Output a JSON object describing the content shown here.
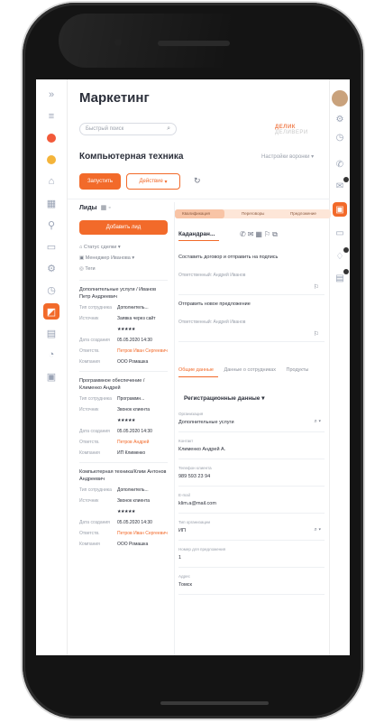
{
  "app": {
    "title": "Маркетинг",
    "search_placeholder": "Быстрый поиск",
    "brand": "ДЕЛИК",
    "brand_suffix": "ДЕЛИВЕРИ"
  },
  "section": {
    "title": "Компьютерная техника",
    "settings": "Настройки воронки"
  },
  "toolbar": {
    "primary": "Запустить",
    "outline": "Действие"
  },
  "leads": {
    "header": "Лиды",
    "add_button": "Добавить лид",
    "filters": [
      "Статус сделки",
      "Менеджер Иванова",
      "Теги"
    ],
    "items": [
      {
        "title": "Дополнительные услуги / Иванов Петр Андреевич",
        "rows": [
          {
            "k": "Тип сотрудника",
            "v": "Дополнитель..."
          },
          {
            "k": "Источник",
            "v": "Заявка через сайт"
          },
          {
            "k": "Дата создания",
            "v": "05.05.2020 14:30"
          },
          {
            "k": "Ответств.",
            "v": "Петров Иван Сергеевич"
          },
          {
            "k": "Компания",
            "v": "ООО Ромашка"
          }
        ]
      },
      {
        "title": "Программное обеспечение / Клименко Андрей",
        "rows": [
          {
            "k": "Тип сотрудника",
            "v": "Программн..."
          },
          {
            "k": "Источник",
            "v": "Звонок клиента"
          },
          {
            "k": "Дата создания",
            "v": "05.05.2020 14:30"
          },
          {
            "k": "Ответств.",
            "v": "Петров Андрей"
          },
          {
            "k": "Компания",
            "v": "ИП Клименко"
          }
        ]
      },
      {
        "title": "Компьютерная техника/Клим Антонов Андреевич",
        "rows": [
          {
            "k": "Тип сотрудника",
            "v": "Дополнитель..."
          },
          {
            "k": "Источник",
            "v": "Звонок клиента"
          },
          {
            "k": "Дата создания",
            "v": "05.05.2020 14:30"
          },
          {
            "k": "Ответств.",
            "v": "Петров Иван Сергеевич"
          },
          {
            "k": "Компания",
            "v": "ООО Ромашка"
          }
        ]
      }
    ]
  },
  "deal": {
    "stages": [
      "Квалификация",
      "Переговоры",
      "Предложение"
    ],
    "title": "Кадандран...",
    "notes": [
      {
        "text": "Составить договор и отправить на подпись",
        "sub": "Ответственный: Андрей Иванов"
      },
      {
        "text": "Отправить новое предложение",
        "sub": "Ответственный: Андрей Иванов"
      }
    ],
    "tabs": [
      "Общие данные",
      "Данные о сотрудниках",
      "Продукты"
    ],
    "reg_header": "Регистрационные данные",
    "fields": [
      {
        "label": "Организация",
        "value": "Дополнительные услуги"
      },
      {
        "label": "Контакт",
        "value": "Клименко Андрей А."
      },
      {
        "label": "Телефон клиента",
        "value": "989 593 23 94"
      },
      {
        "label": "E-mail",
        "value": "klim.a@mail.com"
      },
      {
        "label": "Тип организации",
        "value": "ИП"
      },
      {
        "label": "Номер для предложения",
        "value": "1"
      },
      {
        "label": "Адрес",
        "value": "Томск"
      }
    ]
  },
  "rail_icons": [
    "menu-icon",
    "list-icon",
    "record-icon",
    "star-icon",
    "home-icon",
    "calendar-icon",
    "map-pin-icon",
    "chat-icon",
    "settings-icon",
    "clock-icon",
    "document-icon",
    "file-icon",
    "chart-icon",
    "box-icon"
  ],
  "right_icons": [
    "avatar",
    "gear-icon",
    "clock-icon",
    "phone-icon",
    "mail-icon",
    "chat-icon",
    "doc-icon",
    "bell-icon",
    "file-icon"
  ]
}
